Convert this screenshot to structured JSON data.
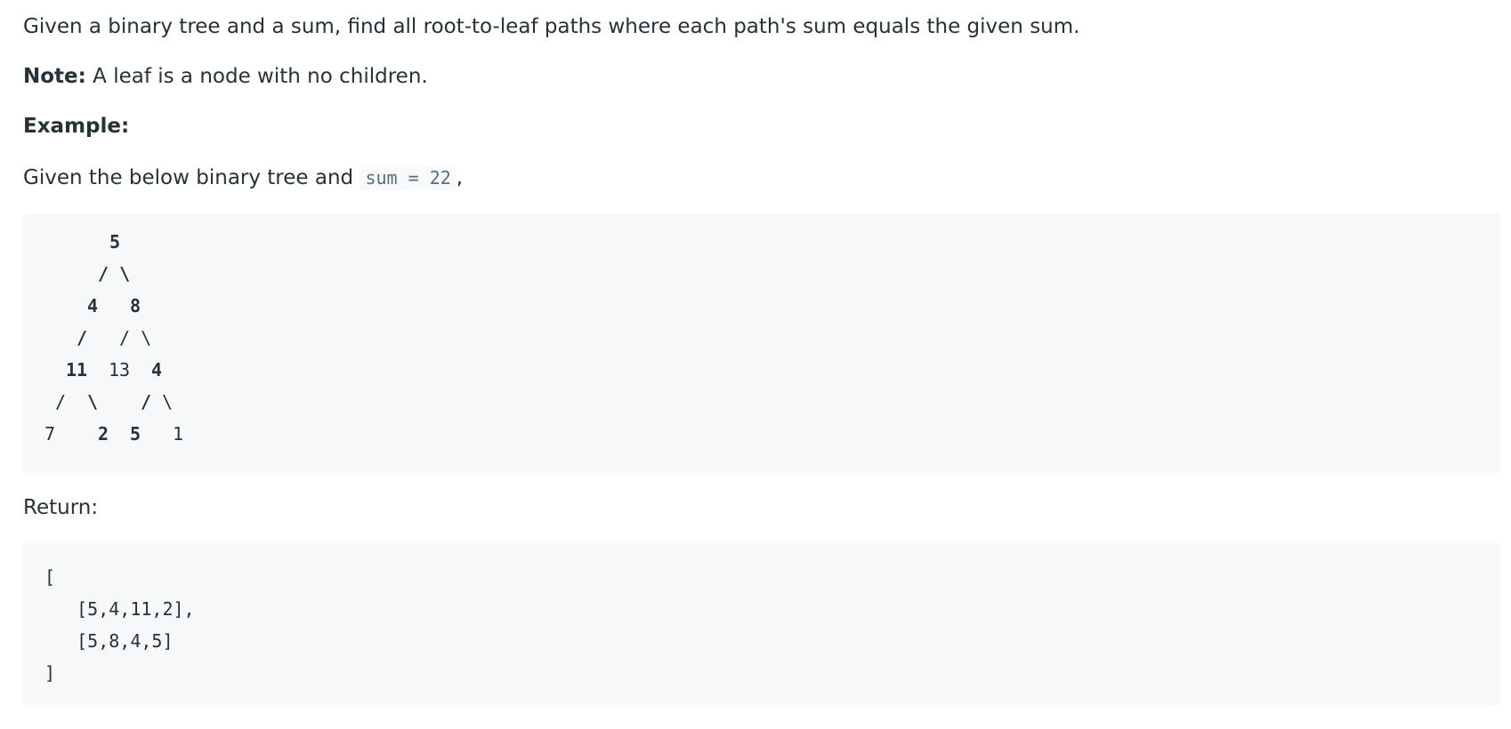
{
  "problem": {
    "intro": "Given a binary tree and a sum, find all root-to-leaf paths where each path's sum equals the given sum.",
    "note_label": "Note:",
    "note_text": " A leaf is a node with no children.",
    "example_label": "Example:",
    "given_prefix": "Given the below binary tree and ",
    "given_code": "sum = 22",
    "given_suffix": ",",
    "return_label": "Return:"
  },
  "tree": {
    "nodes": [
      {
        "text": "5",
        "bold": true
      },
      {
        "text": "/ \\",
        "bold": true
      },
      {
        "text": "4",
        "bold": true
      },
      {
        "text": "8",
        "bold": true
      },
      {
        "text": "/",
        "bold": true
      },
      {
        "text": "/ \\",
        "bold": false
      },
      {
        "text": "11",
        "bold": true
      },
      {
        "text": "13",
        "bold": false
      },
      {
        "text": "4",
        "bold": true
      },
      {
        "text": "/",
        "bold": false
      },
      {
        "text": "\\",
        "bold": true
      },
      {
        "text": "/",
        "bold": true
      },
      {
        "text": "\\",
        "bold": false
      },
      {
        "text": "7",
        "bold": false
      },
      {
        "text": "2",
        "bold": true
      },
      {
        "text": "5",
        "bold": true
      },
      {
        "text": "1",
        "bold": false
      }
    ]
  },
  "result": {
    "lines": [
      "[",
      "   [5,4,11,2],",
      "   [5,8,4,5]",
      "]"
    ]
  }
}
